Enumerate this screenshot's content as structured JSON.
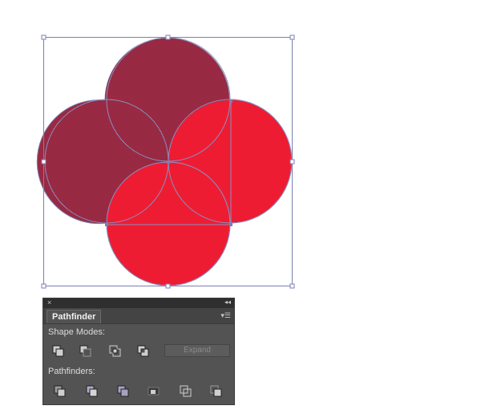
{
  "panel": {
    "close_glyph": "×",
    "collapse_glyph": "◂◂",
    "tab_label": "Pathfinder",
    "menu_glyph": "▾☰",
    "shape_modes_label": "Shape Modes:",
    "expand_label": "Expand",
    "pathfinders_label": "Pathfinders:",
    "shape_mode_icons": [
      "unite-icon",
      "minus-front-icon",
      "intersect-icon",
      "exclude-icon"
    ],
    "pathfinder_icons": [
      "divide-icon",
      "trim-icon",
      "merge-icon",
      "crop-icon",
      "outline-icon",
      "minus-back-icon"
    ]
  },
  "colors": {
    "circle_fill": "#ee1c33",
    "selected_fill": "#8b2239",
    "selection_stroke": "#7a7fb0",
    "panel_bg": "#535353",
    "panel_header": "#2f2f2f"
  }
}
